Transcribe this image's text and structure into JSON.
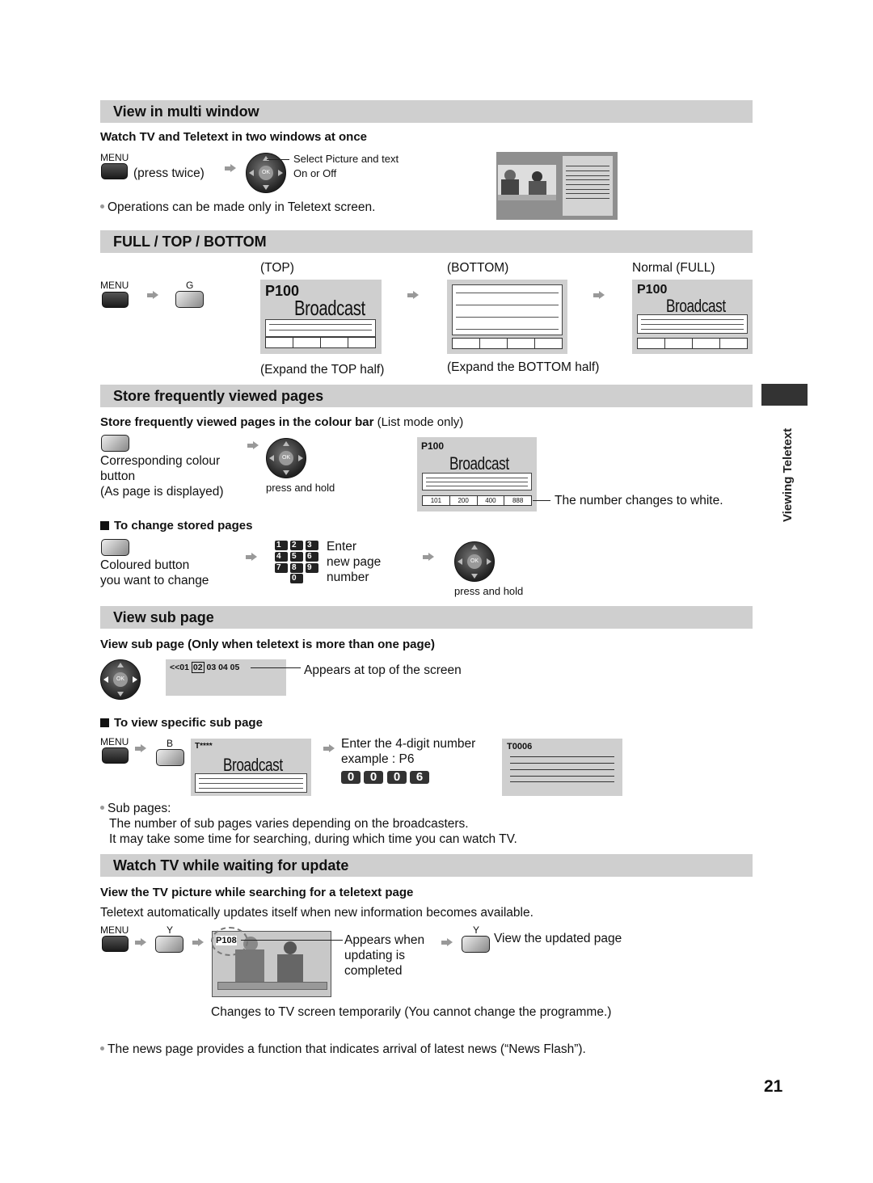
{
  "page_number": "21",
  "side_tab": {
    "label": "Viewing Teletext"
  },
  "sections": {
    "multi_window": {
      "title": "View in multi window",
      "subtitle": "Watch TV and Teletext in two windows at once",
      "menu_label": "MENU",
      "press_note": "(press twice)",
      "callout_line1": "Select Picture and text",
      "callout_line2": "On or Off",
      "ok_label": "OK",
      "note": "Operations can be made only in Teletext screen."
    },
    "full_top_bottom": {
      "title": "FULL / TOP / BOTTOM",
      "menu_label": "MENU",
      "g_label": "G",
      "top_label": "(TOP)",
      "bottom_label": "(BOTTOM)",
      "full_label": "Normal (FULL)",
      "page": "P100",
      "broadcast": "Broadcast",
      "top_caption": "(Expand the TOP half)",
      "bottom_caption": "(Expand the BOTTOM half)"
    },
    "store_pages": {
      "title": "Store frequently viewed pages",
      "subtitle_bold": "Store frequently viewed pages in the colour bar",
      "subtitle_normal": " (List mode only)",
      "step1_line1": "Corresponding colour",
      "step1_line2": "button",
      "step1_line3": "(As page is displayed)",
      "press_hold": "press and hold",
      "ok_label": "OK",
      "page": "P100",
      "broadcast": "Broadcast",
      "colour_bar": [
        "101",
        "200",
        "400",
        "888"
      ],
      "callout": "The number changes to white.",
      "change_heading": "To change stored pages",
      "change_step1_line1": "Coloured button",
      "change_step1_line2": "you want to change",
      "keypad": [
        "1",
        "2",
        "3",
        "4",
        "5",
        "6",
        "7",
        "8",
        "9",
        "0"
      ],
      "enter_line1": "Enter",
      "enter_line2": "new page",
      "enter_line3": "number",
      "press_hold2": "press and hold"
    },
    "sub_page": {
      "title": "View sub page",
      "subtitle": "View sub page (Only when teletext is more than one page)",
      "ok_label": "OK",
      "subpage_prefix": "<<01",
      "subpage_selected": "02",
      "subpage_rest": "03 04 05",
      "callout": "Appears at top of the screen",
      "specific_heading": "To view specific sub page",
      "menu_label": "MENU",
      "b_label": "B",
      "t_page": "T****",
      "broadcast": "Broadcast",
      "enter_line1": "Enter the 4-digit number",
      "enter_line2": "example : P6",
      "digits": [
        "0",
        "0",
        "0",
        "6"
      ],
      "result_page": "T0006",
      "notes_heading": "Sub pages:",
      "note1": "The number of sub pages varies depending on the broadcasters.",
      "note2": "It may take some time for searching, during which time you can watch TV."
    },
    "watch_update": {
      "title": "Watch TV while waiting for update",
      "subtitle": "View the TV picture while searching for a teletext page",
      "description": "Teletext automatically updates itself when new information becomes available.",
      "menu_label": "MENU",
      "y_label": "Y",
      "page_badge": "P108",
      "callout_line1": "Appears when",
      "callout_line2": "updating is",
      "callout_line3": "completed",
      "y_label2": "Y",
      "view_updated": "View the updated page",
      "caption": "Changes to TV screen temporarily (You cannot change the programme.)"
    }
  },
  "footer_note": "The news page provides a function that indicates arrival of latest news (“News Flash”)."
}
